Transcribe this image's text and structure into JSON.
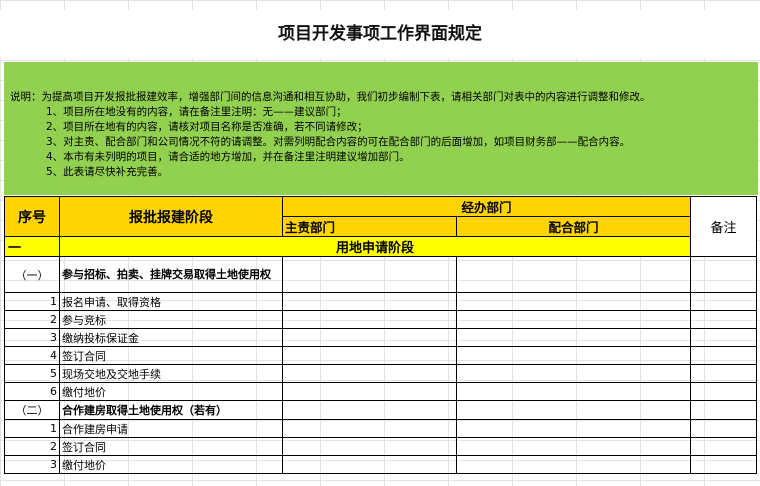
{
  "title": "项目开发事项工作界面规定",
  "notes": {
    "lead": "说明：为提高项目开发报批报建效率，增强部门间的信息沟通和相互协助，我们初步编制下表，请相关部门对表中的内容进行调整和修改。",
    "items": [
      "1、项目所在地没有的内容，请在备注里注明：无——建议部门；",
      "2、项目所在地有的内容，请核对项目名称是否准确，若不同请修改；",
      "3、对主责、配合部门和公司情况不符的请调整。对需列明配合内容的可在配合部门的后面增加，如项目财务部——配合内容。",
      "4、本市有未列明的项目，请合适的地方增加，并在备注里注明建议增加部门。",
      "5、此表请尽快补充完善。"
    ]
  },
  "table": {
    "headers": {
      "seq": "序号",
      "stage": "报批报建阶段",
      "dept": "经办部门",
      "main": "主责部门",
      "assist": "配合部门",
      "remark": "备注"
    },
    "section": {
      "num": "一",
      "label": "用地申请阶段"
    },
    "rows": [
      {
        "num": "（一）",
        "label": "参与招标、拍卖、挂牌交易取得土地使用权",
        "sub": true
      },
      {
        "num": "1",
        "label": "报名申请、取得资格"
      },
      {
        "num": "2",
        "label": "参与竞标"
      },
      {
        "num": "3",
        "label": "缴纳投标保证金"
      },
      {
        "num": "4",
        "label": "签订合同"
      },
      {
        "num": "5",
        "label": "现场交地及交地手续"
      },
      {
        "num": "6",
        "label": "缴付地价"
      },
      {
        "num": "（二）",
        "label": "合作建房取得土地使用权（若有）",
        "sub": true
      },
      {
        "num": "1",
        "label": "合作建房申请"
      },
      {
        "num": "2",
        "label": "签订合同"
      },
      {
        "num": "3",
        "label": "缴付地价"
      }
    ]
  }
}
